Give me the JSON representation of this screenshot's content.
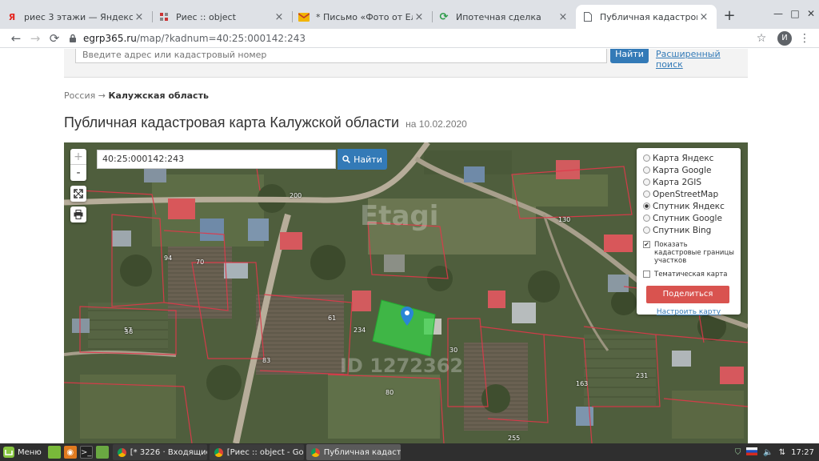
{
  "browser": {
    "tabs": [
      {
        "title": "риес 3 этажи — Яндекс: наш",
        "favicon": "yandex-icon"
      },
      {
        "title": "Риес :: object",
        "favicon": "site-icon"
      },
      {
        "title": "* Письмо «Фото от Елена Со",
        "favicon": "mail-icon"
      },
      {
        "title": "Ипотечная сделка",
        "favicon": "refresh-icon"
      },
      {
        "title": "Публичная кадастровая карт",
        "favicon": "page-icon"
      }
    ],
    "url_host": "egrp365.ru",
    "url_path": "/map/?kadnum=40:25:000142:243",
    "profile_initial": "И"
  },
  "site": {
    "search_placeholder": "Введите адрес или кадастровый номер",
    "search_button": "Найти",
    "advanced_search": "Расширенный поиск"
  },
  "breadcrumb": {
    "root": "Россия",
    "separator": " → ",
    "current": "Калужская область"
  },
  "page": {
    "title": "Публичная кадастровая карта Калужской области",
    "date": "на 10.02.2020"
  },
  "map": {
    "zoom_in": "+",
    "zoom_out": "-",
    "search_value": "40:25:000142:243",
    "search_button": "Найти",
    "layers": [
      {
        "label": "Карта Яндекс",
        "selected": false
      },
      {
        "label": "Карта Google",
        "selected": false
      },
      {
        "label": "Карта 2GIS",
        "selected": false
      },
      {
        "label": "OpenStreetMap",
        "selected": false
      },
      {
        "label": "Спутник Яндекс",
        "selected": true
      },
      {
        "label": "Спутник Google",
        "selected": false
      },
      {
        "label": "Спутник Bing",
        "selected": false
      }
    ],
    "show_borders": "Показать кадастровые границы участков",
    "thematic": "Тематическая карта",
    "share_button": "Поделиться ссылкой",
    "configure_link": "Настроить карту",
    "watermark_id": "ID 1272362",
    "watermark_brand": "Etagi",
    "parcel_labels": [
      "200",
      "70",
      "234",
      "30",
      "80",
      "58",
      "231",
      "163",
      "255",
      "94",
      "57",
      "83",
      "61",
      "130",
      "33"
    ]
  },
  "taskbar": {
    "menu_label": "Меню",
    "tasks": [
      {
        "title": "[* 3226 · Входящие ...",
        "active": false
      },
      {
        "title": "[Риес :: object - Goog...",
        "active": false
      },
      {
        "title": "Публичная кадастр...",
        "active": true
      }
    ],
    "clock": "17:27"
  }
}
